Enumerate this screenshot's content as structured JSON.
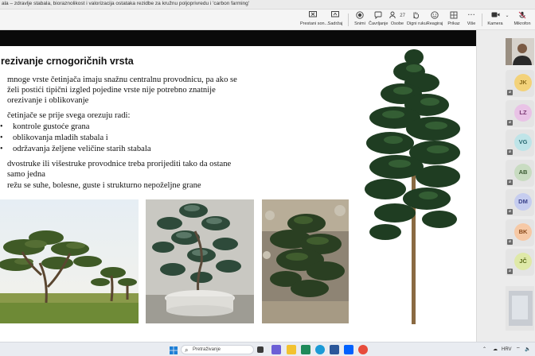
{
  "window": {
    "title": "ala – zdravlje stabala, bioraznolikost i valorizacija ostataka rezidbe za kružnu poljoprivredu i 'carbon farming'"
  },
  "toolbar": {
    "buttons": [
      {
        "label": "Prestani son...",
        "icon": "stop-share-icon"
      },
      {
        "label": "Sadržaj",
        "icon": "share-content-icon"
      },
      {
        "label": "Snimi",
        "icon": "record-icon"
      },
      {
        "label": "Čavrljanje",
        "icon": "chat-icon"
      },
      {
        "label": "Osobe",
        "icon": "people-icon",
        "count": "27"
      },
      {
        "label": "Digni ruku",
        "icon": "raise-hand-icon"
      },
      {
        "label": "Reagiraj",
        "icon": "react-icon"
      },
      {
        "label": "Prikaz",
        "icon": "view-icon"
      },
      {
        "label": "Više",
        "icon": "more-icon"
      },
      {
        "label": "Kamera",
        "icon": "camera-icon"
      },
      {
        "label": "Mikrofon",
        "icon": "microphone-icon"
      }
    ]
  },
  "slide": {
    "title": "rezivanje crnogoričnih vrsta",
    "paragraph1": [
      "mnoge vrste četinjača imaju snažnu centralnu provodnicu, pa ako se",
      "želi postići tipični izgled pojedine vrste nije potrebno znatnije",
      "orezivanje i oblikovanje"
    ],
    "intro": "četinjače se prije svega orezuju radi:",
    "bullets": [
      "kontrole gustoće grana",
      "oblikovanja mladih stabala i",
      "održavanja željene veličine starih stabala"
    ],
    "paragraph2": [
      "dvostruke ili višestruke provodnice treba prorijediti tako da ostane",
      "samo jedna",
      "režu se suhe, bolesne, guste i strukturno nepoželjne grane"
    ]
  },
  "participants": [
    {
      "initials": "",
      "type": "video"
    },
    {
      "initials": "JK",
      "color": "#f3d27a",
      "text": "#8a6a1a"
    },
    {
      "initials": "LZ",
      "color": "#e9c3e6",
      "text": "#7a3a72"
    },
    {
      "initials": "VG",
      "color": "#bfe4e8",
      "text": "#2a6a72"
    },
    {
      "initials": "AB",
      "color": "#c9dcc2",
      "text": "#3a5a32"
    },
    {
      "initials": "DM",
      "color": "#c6cdef",
      "text": "#3a428a"
    },
    {
      "initials": "BK",
      "color": "#f6c9a6",
      "text": "#8a4a1a"
    },
    {
      "initials": "JČ",
      "color": "#dfe9a8",
      "text": "#5a6a1a"
    },
    {
      "initials": "",
      "type": "video"
    }
  ],
  "taskbar": {
    "search_placeholder": "Pretraživanje",
    "language": "HRV"
  }
}
